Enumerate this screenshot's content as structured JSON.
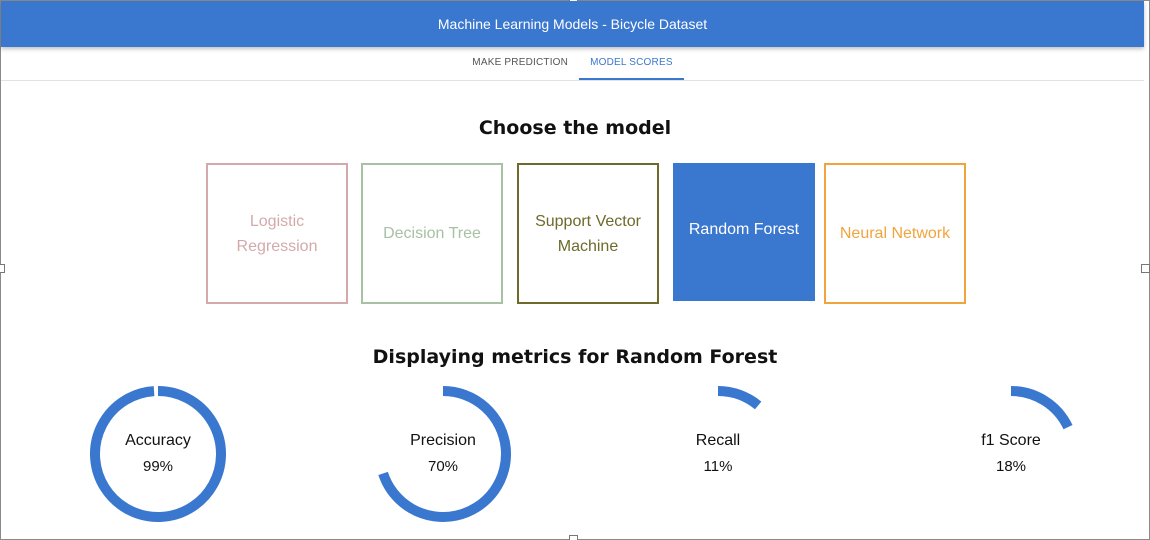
{
  "app": {
    "title": "Machine Learning Models - Bicycle Dataset"
  },
  "tabs": [
    {
      "label": "MAKE PREDICTION",
      "active": false
    },
    {
      "label": "MODEL SCORES",
      "active": true
    }
  ],
  "section": {
    "choose_heading": "Choose the model",
    "metrics_heading": "Displaying metrics for Random Forest"
  },
  "models": [
    {
      "name": "Logistic Regression",
      "color": "#d4a9ab",
      "selected": false
    },
    {
      "name": "Decision Tree",
      "color": "#a6c2a2",
      "selected": false
    },
    {
      "name": "Support Vector Machine",
      "color": "#6d6a2b",
      "selected": false
    },
    {
      "name": "Random Forest",
      "color": "#3a77cf",
      "selected": true
    },
    {
      "name": "Neural Network",
      "color": "#f0a43d",
      "selected": false
    }
  ],
  "metrics": [
    {
      "label": "Accuracy",
      "value_text": "99%",
      "fraction": 0.99
    },
    {
      "label": "Precision",
      "value_text": "70%",
      "fraction": 0.7
    },
    {
      "label": "Recall",
      "value_text": "11%",
      "fraction": 0.11
    },
    {
      "label": "f1 Score",
      "value_text": "18%",
      "fraction": 0.18
    }
  ],
  "colors": {
    "accent": "#3a77cf",
    "ring": "#3a77cf"
  }
}
